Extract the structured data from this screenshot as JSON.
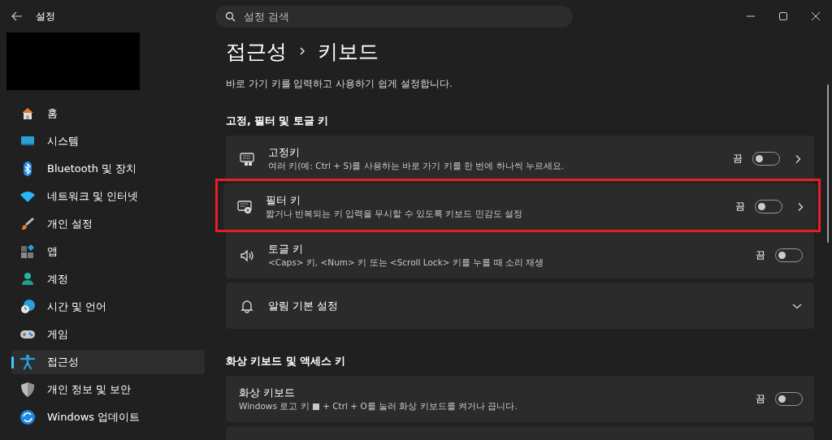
{
  "window": {
    "title": "설정"
  },
  "search": {
    "placeholder": "설정 검색"
  },
  "sidebar": {
    "items": [
      {
        "label": "홈",
        "selected": false
      },
      {
        "label": "시스템",
        "selected": false
      },
      {
        "label": "Bluetooth 및 장치",
        "selected": false
      },
      {
        "label": "네트워크 및 인터넷",
        "selected": false
      },
      {
        "label": "개인 설정",
        "selected": false
      },
      {
        "label": "앱",
        "selected": false
      },
      {
        "label": "계정",
        "selected": false
      },
      {
        "label": "시간 및 언어",
        "selected": false
      },
      {
        "label": "게임",
        "selected": false
      },
      {
        "label": "접근성",
        "selected": true
      },
      {
        "label": "개인 정보 및 보안",
        "selected": false
      },
      {
        "label": "Windows 업데이트",
        "selected": false
      }
    ]
  },
  "breadcrumb": [
    "접근성",
    "키보드"
  ],
  "description": "바로 가기 키를 입력하고 사용하기 쉽게 설정합니다.",
  "sections": [
    {
      "title": "고정, 필터 및 토글 키",
      "rows": [
        {
          "kind": "toggle",
          "title": "고정키",
          "description": "여러 키(예: Ctrl + S)를 사용하는 바로 가기 키를 한 번에 하나씩 누르세요.",
          "state_label": "끔",
          "on": false,
          "chevron": true,
          "highlighted": false
        },
        {
          "kind": "toggle",
          "title": "필터 키",
          "description": "짧거나 반복되는 키 입력을 무시할 수 있도록 키보드 민감도 설정",
          "state_label": "끔",
          "on": false,
          "chevron": true,
          "highlighted": true
        },
        {
          "kind": "toggle",
          "title": "토글 키",
          "description": "<Caps> 키, <Num> 키 또는 <Scroll Lock> 키를 누를 때 소리 재생",
          "state_label": "끔",
          "on": false,
          "chevron": false,
          "highlighted": false
        },
        {
          "kind": "expander",
          "title": "알림 기본 설정",
          "expanded": false,
          "highlighted": false
        }
      ]
    },
    {
      "title": "화상 키보드 및 액세스 키",
      "rows": [
        {
          "kind": "toggle",
          "title": "화상 키보드",
          "description": "Windows 로고 키 ■ + Ctrl + O를 눌러 화상 키보드를 켜거나 끕니다.",
          "state_label": "끔",
          "on": false,
          "chevron": false,
          "highlighted": false
        },
        {
          "kind": "partial"
        }
      ]
    }
  ]
}
